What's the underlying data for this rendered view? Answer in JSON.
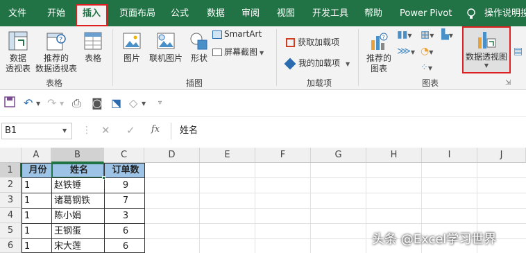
{
  "ribbon_tabs": [
    "文件",
    "开始",
    "插入",
    "页面布局",
    "公式",
    "数据",
    "审阅",
    "视图",
    "开发工具",
    "帮助",
    "Power Pivot"
  ],
  "active_tab": "插入",
  "tell_me": "操作说明搜",
  "groups": {
    "tables": {
      "label": "表格",
      "buttons": [
        "数据\n透视表",
        "推荐的\n数据透视表",
        "表格"
      ]
    },
    "illustrations": {
      "label": "插图",
      "buttons": [
        "图片",
        "联机图片",
        "形状"
      ],
      "small": [
        "SmartArt",
        "屏幕截图"
      ]
    },
    "addins": {
      "label": "加载项",
      "items": [
        "获取加载项",
        "我的加载项"
      ]
    },
    "charts": {
      "label": "图表",
      "recommended": "推荐的\n图表",
      "pivot_chart": "数据透视图"
    }
  },
  "namebox": "B1",
  "formula_value": "姓名",
  "columns": [
    "A",
    "B",
    "C",
    "D",
    "E",
    "F",
    "G",
    "H",
    "I",
    "J"
  ],
  "rows": [
    "1",
    "2",
    "3",
    "4",
    "5",
    "6"
  ],
  "table": {
    "headers": [
      "月份",
      "姓名",
      "订单数"
    ],
    "data": [
      [
        "1",
        "赵铁锤",
        "9"
      ],
      [
        "1",
        "诸葛钢铁",
        "7"
      ],
      [
        "1",
        "陈小娟",
        "3"
      ],
      [
        "1",
        "王钢蛋",
        "6"
      ],
      [
        "1",
        "宋大莲",
        "6"
      ]
    ]
  },
  "watermark": "头条 @Excel学习世界",
  "colors": {
    "brand": "#217346",
    "highlight": "#e02020",
    "header_fill": "#9dc3e6"
  }
}
